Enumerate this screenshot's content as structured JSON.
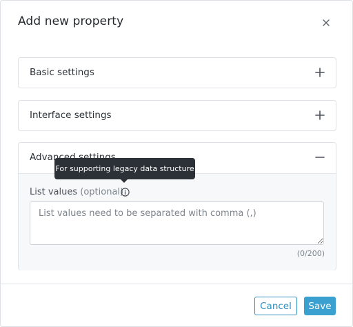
{
  "modal": {
    "title": "Add new property",
    "close_icon": "close-icon"
  },
  "sections": [
    {
      "label": "Basic settings",
      "toggle_icon": "plus-icon",
      "expanded": false
    },
    {
      "label": "Interface settings",
      "toggle_icon": "plus-icon",
      "expanded": false
    },
    {
      "label": "Advanced settings",
      "toggle_icon": "minus-icon",
      "expanded": true
    }
  ],
  "advanced": {
    "field_label": "List values",
    "field_optional": "(optional)",
    "info_icon": "info-icon",
    "tooltip": "For supporting legacy data structure",
    "placeholder": "List values need to be separated with comma (,)",
    "value": "",
    "counter": "(0/200)"
  },
  "footer": {
    "cancel_label": "Cancel",
    "save_label": "Save"
  },
  "colors": {
    "primary": "#3aa0d0",
    "primary_outline": "#2f8fbd",
    "tooltip_bg": "#2b3137"
  }
}
